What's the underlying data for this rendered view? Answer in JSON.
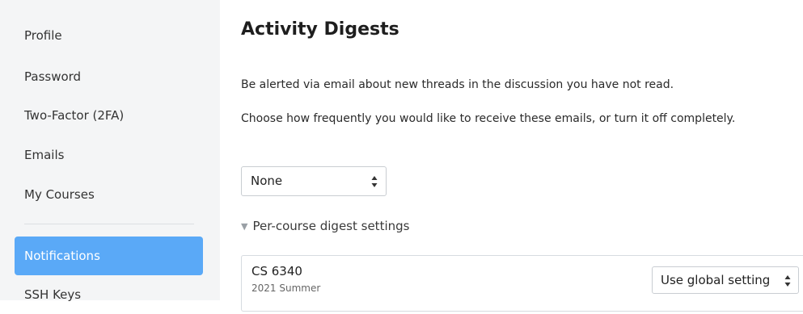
{
  "sidebar": {
    "items": [
      {
        "label": "Profile",
        "active": false
      },
      {
        "label": "Password",
        "active": false
      },
      {
        "label": "Two-Factor (2FA)",
        "active": false
      },
      {
        "label": "Emails",
        "active": false
      },
      {
        "label": "My Courses",
        "active": false
      },
      {
        "label": "Notifications",
        "active": true
      },
      {
        "label": "SSH Keys",
        "active": false
      }
    ]
  },
  "main": {
    "title": "Activity Digests",
    "description": "Be alerted via email about new threads in the discussion you have not read.",
    "frequency_prompt": "Choose how frequently you would like to receive these emails, or turn it off completely.",
    "frequency_select": {
      "selected": "None"
    },
    "per_course": {
      "toggle_label": "Per-course digest settings",
      "expanded": true,
      "courses": [
        {
          "code": "CS 6340",
          "term": "2021 Summer",
          "setting": "Use global setting"
        }
      ]
    }
  },
  "colors": {
    "sidebar_bg": "#f4f5f6",
    "active_item_bg": "#5aa9f7",
    "active_item_text": "#ffffff"
  }
}
